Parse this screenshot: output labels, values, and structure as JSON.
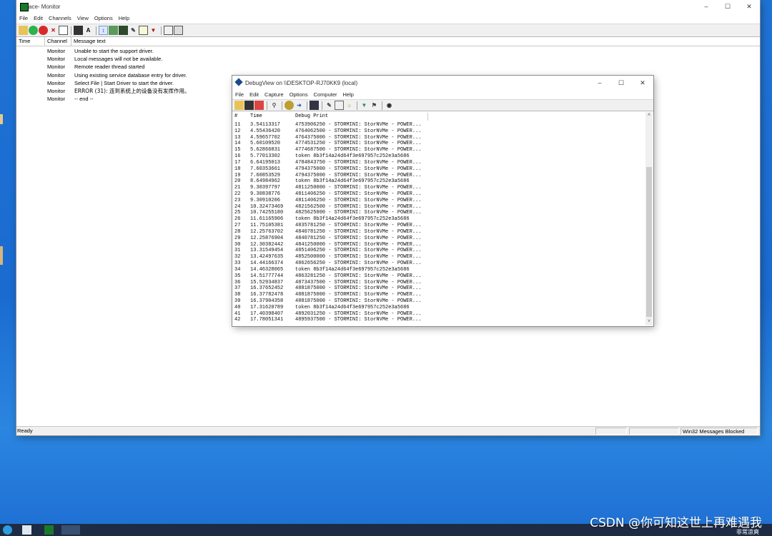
{
  "monitor": {
    "title": "ace- Monitor",
    "menu": [
      "File",
      "Edit",
      "Channels",
      "View",
      "Options",
      "Help"
    ],
    "columns": [
      "Time",
      "Channel",
      "Message text"
    ],
    "rows": [
      {
        "time": "",
        "channel": "Monitor",
        "message": "Unable to start the support driver."
      },
      {
        "time": "",
        "channel": "Monitor",
        "message": "Local messages will not be available."
      },
      {
        "time": "",
        "channel": "Monitor",
        "message": "Remote reader thread started"
      },
      {
        "time": "",
        "channel": "Monitor",
        "message": "Using existing service database entry for driver."
      },
      {
        "time": "",
        "channel": "Monitor",
        "message": "Select File | Start Driver to start the driver."
      },
      {
        "time": "",
        "channel": "Monitor",
        "message": "ERROR (31): 连到系统上的设备没有发挥作用。"
      },
      {
        "time": "",
        "channel": "Monitor",
        "message": " -- end --"
      }
    ],
    "status": {
      "left": "Ready",
      "right": "Win32 Messages Blocked"
    }
  },
  "debugview": {
    "title": "DebugView on \\\\DESKTOP-RJ70KK9 (local)",
    "menu": [
      "File",
      "Edit",
      "Capture",
      "Options",
      "Computer",
      "Help"
    ],
    "columns": [
      "#",
      "Time",
      "Debug Print"
    ],
    "rows": [
      {
        "n": "11",
        "time": "3.54113317",
        "print": "4753906250 - STORMINI: StorNVMe - POWER..."
      },
      {
        "n": "12",
        "time": "4.55436420",
        "print": "4764062500 - STORMINI: StorNVMe - POWER..."
      },
      {
        "n": "13",
        "time": "4.59657702",
        "print": "4764375000 - STORMINI: StorNVMe - POWER..."
      },
      {
        "n": "14",
        "time": "5.60109520",
        "print": "4774531250 - STORMINI: StorNVMe - POWER..."
      },
      {
        "n": "15",
        "time": "5.62866831",
        "print": "4774687500 - STORMINI: StorNVMe - POWER..."
      },
      {
        "n": "16",
        "time": "5.77013302",
        "print": "token 8b3f14a24d64f3e697957c252e3a5686"
      },
      {
        "n": "17",
        "time": "6.64195013",
        "print": "4784843750 - STORMINI: StorNVMe - POWER..."
      },
      {
        "n": "18",
        "time": "7.60353661",
        "print": "4794375000 - STORMINI: StorNVMe - POWER..."
      },
      {
        "n": "19",
        "time": "7.60853529",
        "print": "4794375000 - STORMINI: StorNVMe - POWER..."
      },
      {
        "n": "20",
        "time": "8.64984962",
        "print": "token 8b3f14a24d64f3e697957c252e3a5686"
      },
      {
        "n": "21",
        "time": "9.30397797",
        "print": "4811250000 - STORMINI: StorNVMe - POWER..."
      },
      {
        "n": "22",
        "time": "9.30838776",
        "print": "4811406250 - STORMINI: StorNVMe - POWER..."
      },
      {
        "n": "23",
        "time": "9.30910206",
        "print": "4811406250 - STORMINI: StorNVMe - POWER..."
      },
      {
        "n": "24",
        "time": "10.32473469",
        "print": "4821562500 - STORMINI: StorNVMe - POWER..."
      },
      {
        "n": "25",
        "time": "10.74255180",
        "print": "4825625000 - STORMINI: StorNVMe - POWER..."
      },
      {
        "n": "26",
        "time": "11.61165906",
        "print": "token 8b3f14a24d64f3e697957c252e3a5686"
      },
      {
        "n": "27",
        "time": "11.75105381",
        "print": "4835781250 - STORMINI: StorNVMe - POWER..."
      },
      {
        "n": "28",
        "time": "12.25763702",
        "print": "4840781250 - STORMINI: StorNVMe - POWER..."
      },
      {
        "n": "29",
        "time": "12.25876904",
        "print": "4840781250 - STORMINI: StorNVMe - POWER..."
      },
      {
        "n": "30",
        "time": "12.30382442",
        "print": "4841250000 - STORMINI: StorNVMe - POWER..."
      },
      {
        "n": "31",
        "time": "13.31549454",
        "print": "4851406250 - STORMINI: StorNVMe - POWER..."
      },
      {
        "n": "32",
        "time": "13.42497635",
        "print": "4852500000 - STORMINI: StorNVMe - POWER..."
      },
      {
        "n": "33",
        "time": "14.44166374",
        "print": "4862656250 - STORMINI: StorNVMe - POWER..."
      },
      {
        "n": "34",
        "time": "14.46328065",
        "print": "token 8b3f14a24d64f3e697957c252e3a5686"
      },
      {
        "n": "35",
        "time": "14.51777744",
        "print": "4863281250 - STORMINI: StorNVMe - POWER..."
      },
      {
        "n": "36",
        "time": "15.52934837",
        "print": "4873437500 - STORMINI: StorNVMe - POWER..."
      },
      {
        "n": "37",
        "time": "16.37652452",
        "print": "4881875000 - STORMINI: StorNVMe - POWER..."
      },
      {
        "n": "38",
        "time": "16.37782478",
        "print": "4881875000 - STORMINI: StorNVMe - POWER..."
      },
      {
        "n": "39",
        "time": "16.37904358",
        "print": "4881875000 - STORMINI: StorNVMe - POWER..."
      },
      {
        "n": "40",
        "time": "17.31620789",
        "print": "token 8b3f14a24d64f3e697957c252e3a5686"
      },
      {
        "n": "41",
        "time": "17.40398407",
        "print": "4892031250 - STORMINI: StorNVMe - POWER..."
      },
      {
        "n": "42",
        "time": "17.78051341",
        "print": "4895937500 - STORMINI: StorNVMe - POWER..."
      }
    ],
    "scroll_position": 0.72
  },
  "watermark": "CSDN @你可知这世上再难遇我",
  "tray_label": "非常凉爽",
  "icons": {
    "monitor_toolbar": [
      "open-icon",
      "start-icon",
      "stop-icon",
      "clear-icon",
      "capture-icon",
      "save-icon",
      "font-icon",
      "autoscroll-icon",
      "properties-icon",
      "save-log-icon",
      "highlight-icon",
      "edit-filter-icon",
      "filter-icon",
      "print-icon",
      "remote-icon"
    ],
    "debugview_toolbar": [
      "open-icon",
      "save-icon",
      "clear-icon",
      "find-icon",
      "capture-icon",
      "autoscroll-icon",
      "properties-icon",
      "edit-icon",
      "history-icon",
      "highlight-icon",
      "filter-icon",
      "flag-icon",
      "find-binoculars-icon"
    ]
  }
}
